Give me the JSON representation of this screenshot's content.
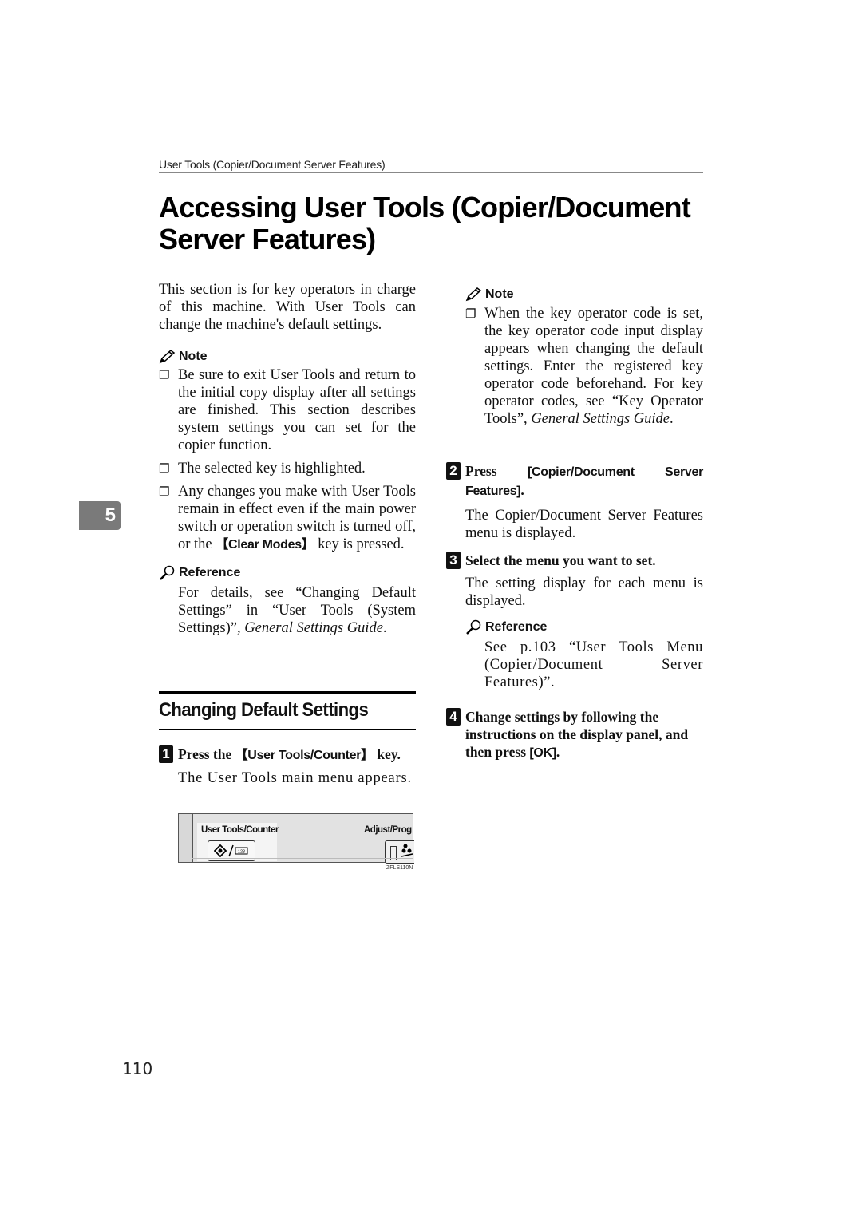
{
  "running_header": "User Tools (Copier/Document Server Features)",
  "page_title": "Accessing User Tools (Copier/Document Server Features)",
  "chapter_number": "5",
  "page_number": "110",
  "intro": "This section is for key operators in charge of this machine. With User Tools can change the machine's default settings.",
  "left_note": {
    "heading": "Note",
    "items": [
      "Be sure to exit User Tools and return to the initial copy display after all settings are finished. This section describes system settings you can set for the copier function.",
      "The selected key is highlighted.",
      {
        "before": "Any changes you make with User Tools remain in effect even if the main power switch or operation switch is turned off, or the ",
        "key": "【Clear Modes】",
        "after": " key is pressed."
      }
    ]
  },
  "left_reference": {
    "heading": "Reference",
    "text_before": "For details, see “Changing Default Settings” in “User Tools (System Settings)”, ",
    "text_italic": "General Settings Guide",
    "text_after": "."
  },
  "section_title": "Changing Default Settings",
  "steps": [
    {
      "number": "1",
      "instruction_before": "Press the ",
      "instruction_key": "【User Tools/Counter】",
      "instruction_after": " key.",
      "result": "The User Tools main menu appears."
    },
    {
      "number": "2",
      "instruction_before": "Press ",
      "instruction_key": "[Copier/Document Server Features]",
      "instruction_after": ".",
      "result": "The Copier/Document Server Features menu is displayed."
    },
    {
      "number": "3",
      "instruction": "Select the menu you want to set.",
      "result": "The setting display for each menu is displayed."
    },
    {
      "number": "4",
      "instruction_before": "Change settings by following the instructions on the display panel, and then press ",
      "instruction_key": "[OK]",
      "instruction_after": "."
    }
  ],
  "figure": {
    "label_left": "User Tools/Counter",
    "label_right": "Adjust/Prog",
    "button_glyph": "123",
    "caption": "ZFLS110N"
  },
  "right_note": {
    "heading": "Note",
    "text_before": "When the key operator code is set, the key operator code input display appears when changing the default settings. Enter the registered key operator code beforehand. For key operator codes, see “Key Operator Tools”, ",
    "text_italic": "General Settings Guide",
    "text_after": "."
  },
  "right_reference": {
    "heading": "Reference",
    "text": "See p.103 “User Tools Menu (Copier/Document Server Features)”."
  }
}
